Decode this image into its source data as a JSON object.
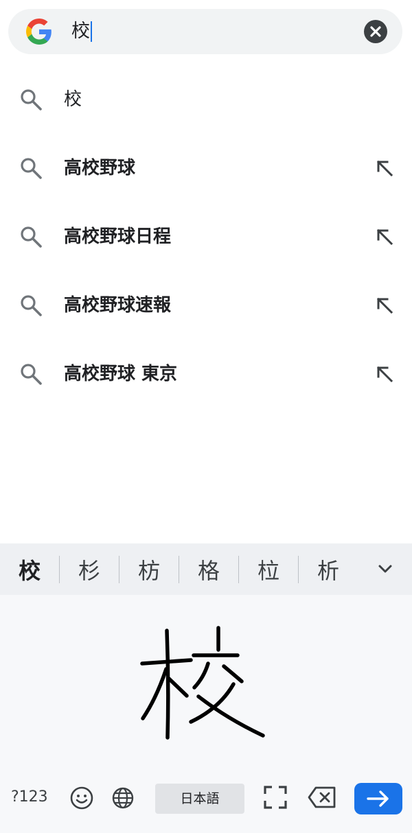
{
  "search": {
    "query": "校",
    "logo_icon": "google-g-icon",
    "clear_icon": "close-circle-icon"
  },
  "suggestions": [
    {
      "text": "校",
      "bold": false,
      "has_fill_arrow": false
    },
    {
      "text": "高校野球",
      "bold": true,
      "has_fill_arrow": true
    },
    {
      "text": "高校野球日程",
      "bold": true,
      "has_fill_arrow": true
    },
    {
      "text": "高校野球速報",
      "bold": true,
      "has_fill_arrow": true
    },
    {
      "text": "高校野球 東京",
      "bold": true,
      "has_fill_arrow": true
    }
  ],
  "candidates": [
    "校",
    "杉",
    "枋",
    "格",
    "柆",
    "析"
  ],
  "keyboard": {
    "symbols_label": "?123",
    "language_label": "日本語",
    "emoji_icon": "smiley-icon",
    "globe_icon": "globe-icon",
    "fullscreen_icon": "fullscreen-icon",
    "backspace_icon": "backspace-icon",
    "enter_icon": "arrow-right-icon"
  },
  "colors": {
    "accent": "#1a73e8",
    "search_bg": "#f1f3f4",
    "candidate_bg": "#eef0f3",
    "pad_bg": "#f7f8fa"
  }
}
